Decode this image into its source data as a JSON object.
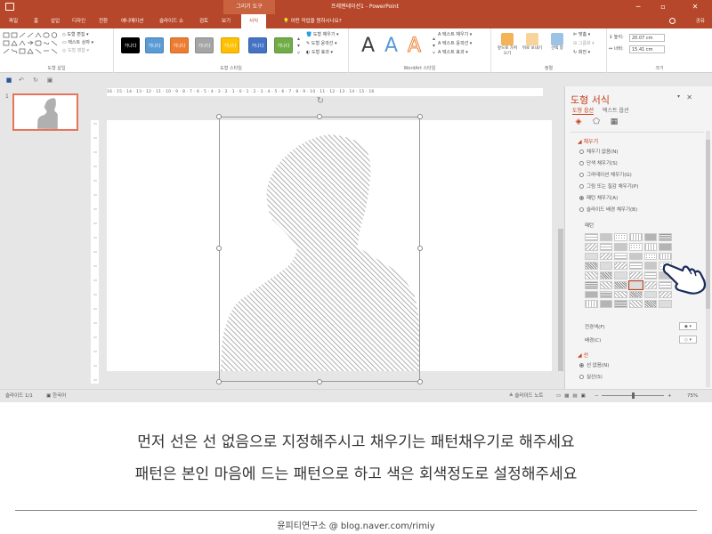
{
  "app": {
    "contextual_tab_group": "그리기 도구",
    "window_title": "프레젠테이션1 - PowerPoint"
  },
  "window_controls": {
    "minimize": "─",
    "restore": "▫",
    "close": "✕"
  },
  "tabs": [
    {
      "label": "파일"
    },
    {
      "label": "홈"
    },
    {
      "label": "삽입"
    },
    {
      "label": "디자인"
    },
    {
      "label": "전환"
    },
    {
      "label": "애니메이션"
    },
    {
      "label": "슬라이드 쇼"
    },
    {
      "label": "검토"
    },
    {
      "label": "보기"
    },
    {
      "label": "서식",
      "active": true
    }
  ],
  "tell_me": "어떤 작업을 원하시나요?",
  "share": "공유",
  "ribbon": {
    "insert_shapes": {
      "label": "도형 삽입",
      "edit_shape": "도형 편집",
      "text_box": "텍스트 상자",
      "merge_shapes": "도형 병합"
    },
    "shape_styles": {
      "label": "도형 스타일",
      "swatch_text": "가나다",
      "swatches": [
        "#000000",
        "#5b9bd5",
        "#ed7d31",
        "#a5a5a5",
        "#ffc000",
        "#4472c4",
        "#70ad47"
      ],
      "fill": "도형 채우기",
      "outline": "도형 윤곽선",
      "effects": "도형 효과"
    },
    "wordart": {
      "label": "WordArt 스타일",
      "letter": "A",
      "text_fill": "텍스트 채우기",
      "text_outline": "텍스트 윤곽선",
      "text_effects": "텍스트 효과"
    },
    "arrange": {
      "label": "정렬",
      "bring_forward": "앞으로 가져오기",
      "send_backward": "뒤로 보내기",
      "selection_pane": "선택 창",
      "align": "맞춤",
      "group": "그룹화",
      "rotate": "회전"
    },
    "size": {
      "label": "크기",
      "height": "20.07 cm",
      "width": "15.41 cm"
    }
  },
  "thumbnail": {
    "number": "1"
  },
  "ruler": {
    "numbers": "16 · 15 · 14 · 13 · 12 · 11 · 10 · 9 · 8 · 7 · 6 · 5 · 4 · 3 · 2 · 1 · 0 · 1 · 2 · 3 · 4 · 5 · 6 · 7 · 8 · 9 · 10 · 11 · 12 · 13 · 14 · 15 · 16"
  },
  "format_pane": {
    "title": "도형 서식",
    "tab_shape": "도형 옵션",
    "tab_text": "텍스트 옵션",
    "fill_section": "채우기",
    "fill_options": [
      {
        "label": "채우기 없음(N)",
        "selected": false
      },
      {
        "label": "단색 채우기(S)",
        "selected": false
      },
      {
        "label": "그라데이션 채우기(G)",
        "selected": false
      },
      {
        "label": "그림 또는 질감 채우기(P)",
        "selected": false
      },
      {
        "label": "패턴 채우기(A)",
        "selected": true
      },
      {
        "label": "슬라이드 배경 채우기(B)",
        "selected": false
      }
    ],
    "pattern_label": "패턴",
    "foreground": "전경색(F)",
    "background": "배경(C)",
    "line_section": "선",
    "line_options": [
      {
        "label": "선 없음(N)",
        "selected": true
      },
      {
        "label": "실선(S)",
        "selected": false
      }
    ]
  },
  "statusbar": {
    "slide_count": "슬라이드 1/1",
    "language": "한국어",
    "notes": "슬라이드 노트",
    "zoom": "75%"
  },
  "caption": {
    "line1": "먼저 선은 선 없음으로 지정해주시고 채우기는 패턴채우기로 해주세요",
    "line2": "패턴은 본인 마음에 드는 패턴으로 하고 색은 회색정도로 설정해주세요",
    "credit": "윤피티연구소 @ blog.naver.com/rimiy"
  },
  "colors": {
    "accent": "#b7472a",
    "pane_accent": "#c43e1c",
    "pattern_gray": "#9a9a9a"
  }
}
